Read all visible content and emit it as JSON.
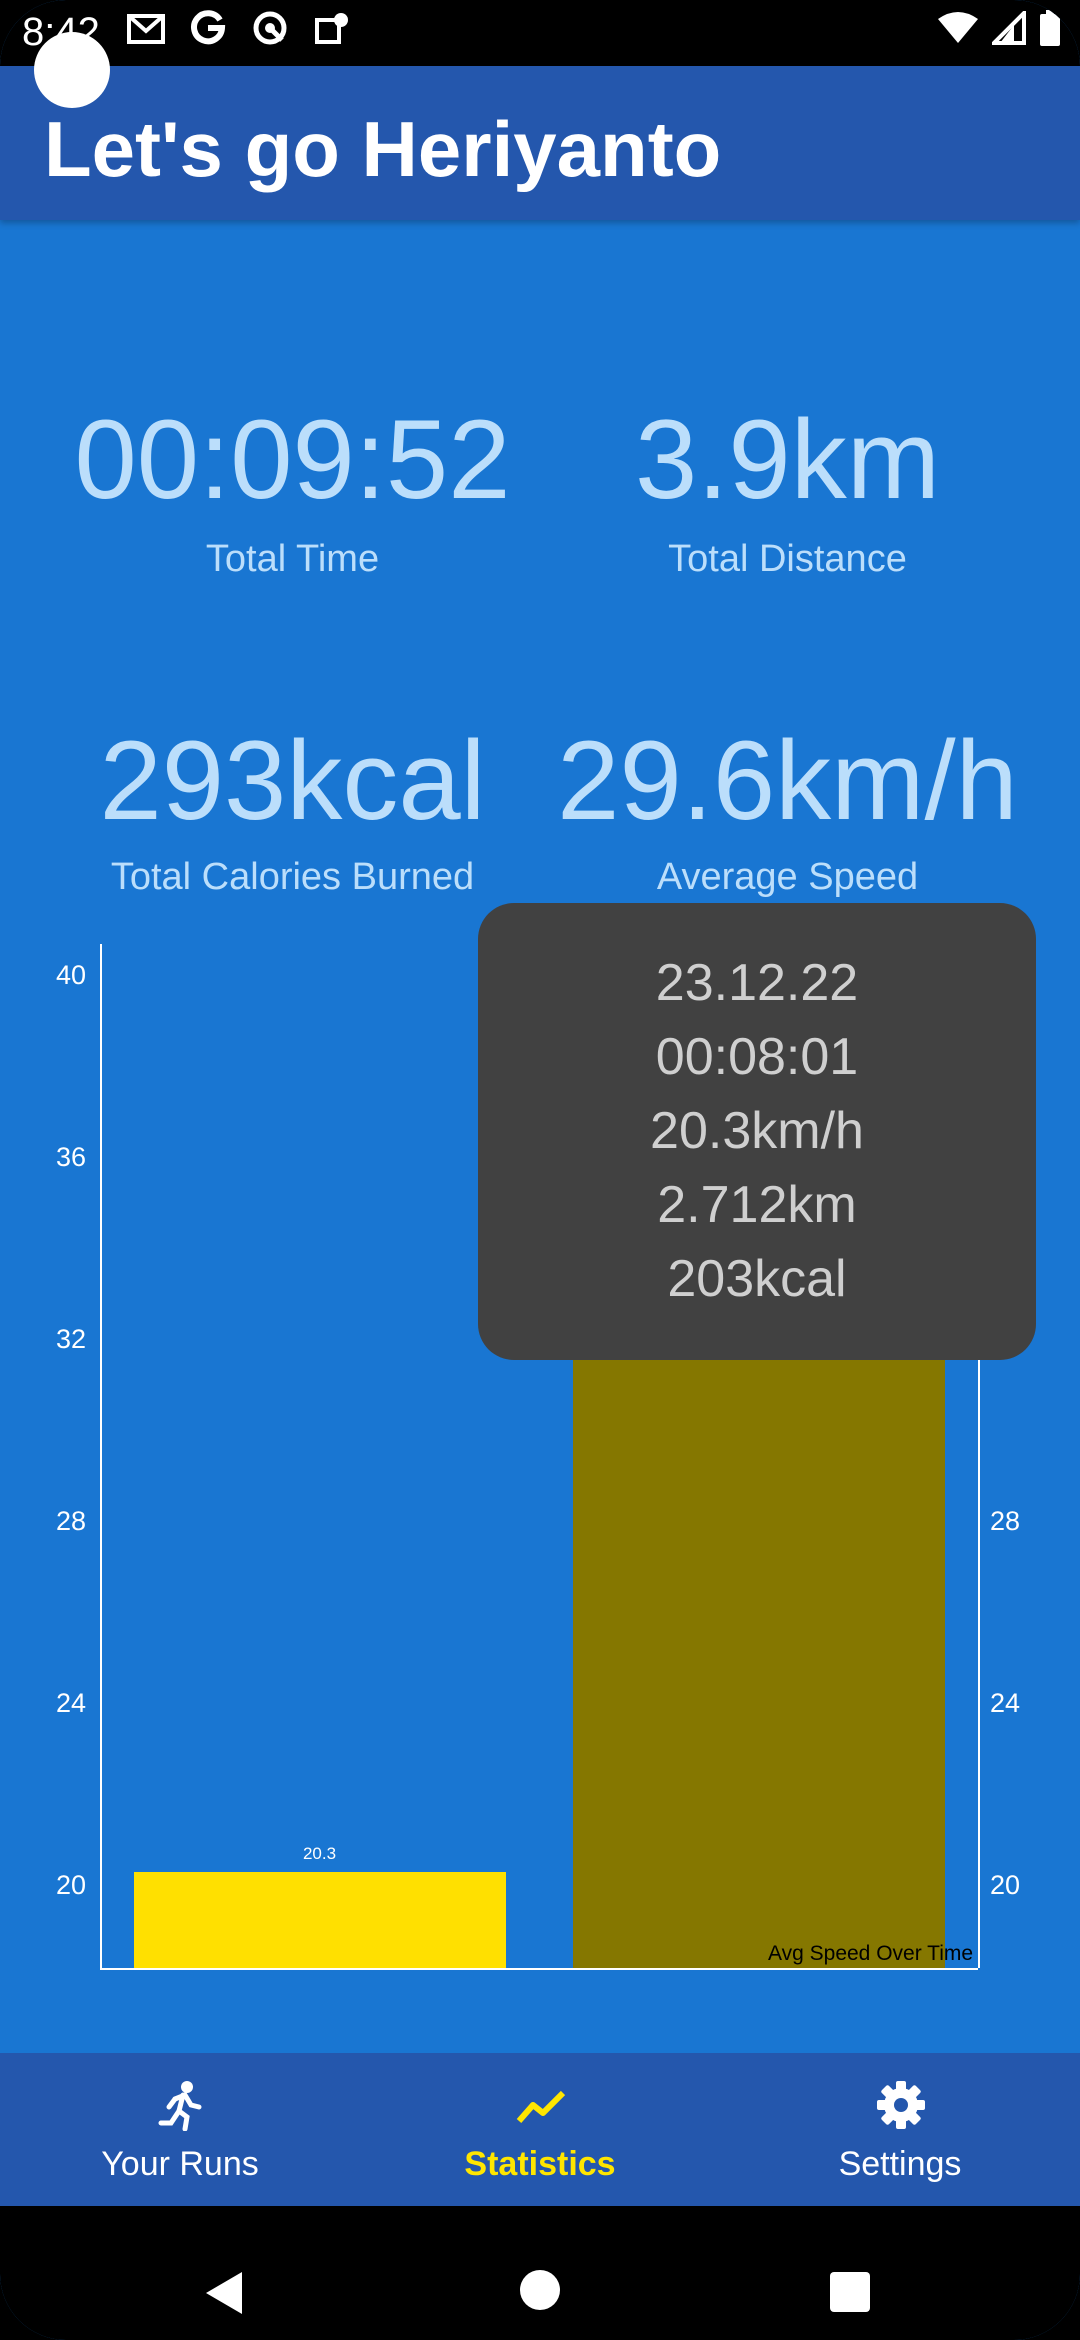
{
  "status_bar": {
    "time": "8:42",
    "left_icons": [
      "gmail-icon",
      "google-icon",
      "signal-app-icon",
      "maps-icon"
    ],
    "right_icons": [
      "wifi-icon",
      "cell-signal-icon",
      "battery-icon"
    ]
  },
  "app_bar": {
    "title": "Let's go Heriyanto"
  },
  "stats": [
    {
      "value": "00:09:52",
      "label": "Total Time"
    },
    {
      "value": "3.9km",
      "label": "Total Distance"
    },
    {
      "value": "293kcal",
      "label": "Total Calories Burned"
    },
    {
      "value": "29.6km/h",
      "label": "Average Speed"
    }
  ],
  "colors": {
    "background": "#1976D2",
    "app_bar": "#2457AD",
    "stat_text": "#BBDEFB",
    "bar_primary": "#FFE000",
    "bar_highlighted": "#857700",
    "tooltip_bg": "#414141",
    "accent_active": "#FFE600"
  },
  "chart_data": {
    "type": "bar",
    "categories": [
      "",
      "23.12.22"
    ],
    "values": [
      20.3,
      38.9
    ],
    "value_labels": [
      "20.3",
      ""
    ],
    "description": "Avg Speed Over Time",
    "y_ticks": [
      "40",
      "36",
      "32",
      "28",
      "24",
      "20"
    ],
    "y_right_ticks": [
      "28",
      "24",
      "20"
    ],
    "ylim": [
      18.2,
      40.7
    ],
    "highlighted_index": 1,
    "grid": false
  },
  "tooltip": {
    "lines": [
      "23.12.22",
      "00:08:01",
      "20.3km/h",
      "2.712km",
      "203kcal"
    ]
  },
  "bottom_nav": {
    "items": [
      {
        "label": "Your Runs",
        "icon": "running-person-icon",
        "active": false
      },
      {
        "label": "Statistics",
        "icon": "trend-chart-icon",
        "active": true
      },
      {
        "label": "Settings",
        "icon": "gear-icon",
        "active": false
      }
    ]
  },
  "system_nav": {
    "buttons": [
      "back-icon",
      "home-icon",
      "recents-icon"
    ]
  }
}
